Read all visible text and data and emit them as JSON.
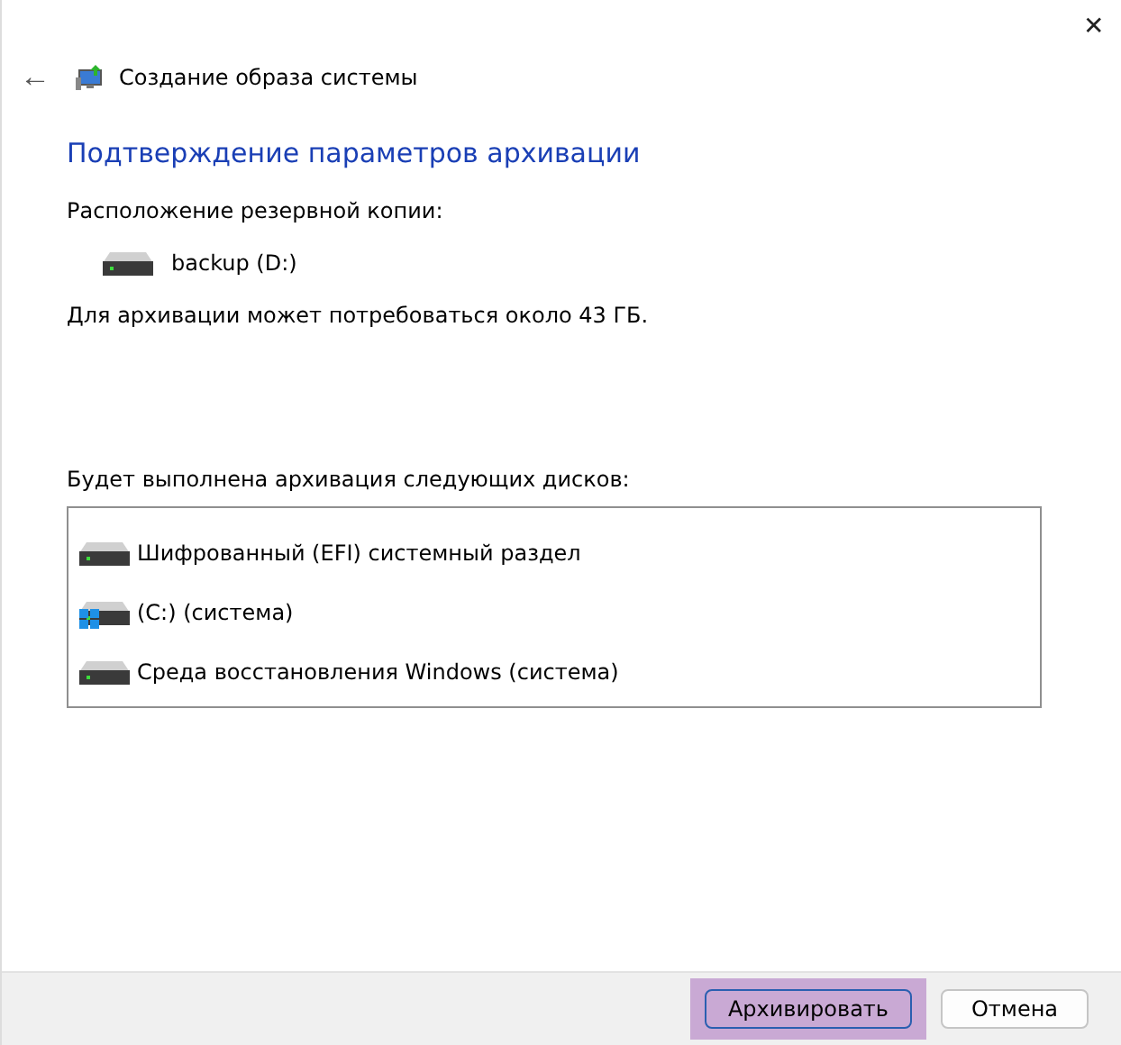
{
  "window": {
    "title": "Создание образа системы",
    "close": "✕",
    "back": "←"
  },
  "heading": "Подтверждение параметров архивации",
  "location_label": "Расположение резервной копии:",
  "location": {
    "name": "backup (D:)"
  },
  "space_note": "Для архивации может потребоваться около 43 ГБ.",
  "disks_label": "Будет выполнена архивация следующих дисков:",
  "disks": [
    {
      "name": "Шифрованный (EFI) системный раздел",
      "kind": "drive"
    },
    {
      "name": "(C:) (система)",
      "kind": "system"
    },
    {
      "name": "Среда восстановления Windows (система)",
      "kind": "drive"
    }
  ],
  "buttons": [
    {
      "label": "Архивировать",
      "kind": "primary",
      "highlighted": true
    },
    {
      "label": "Отмена",
      "kind": "secondary",
      "highlighted": false
    }
  ]
}
